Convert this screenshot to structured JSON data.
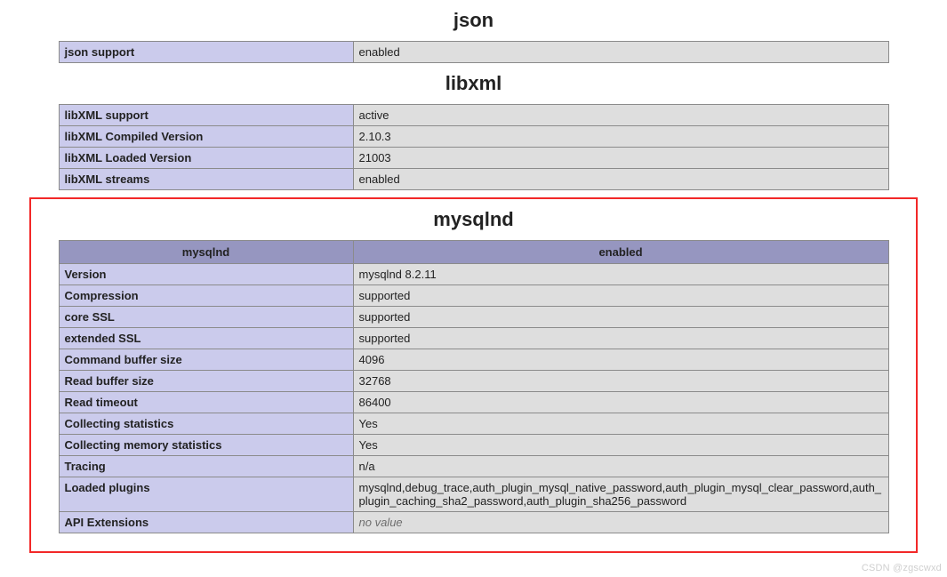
{
  "sections": {
    "json": {
      "title": "json",
      "rows": [
        {
          "key": "json support",
          "val": "enabled"
        }
      ]
    },
    "libxml": {
      "title": "libxml",
      "rows": [
        {
          "key": "libXML support",
          "val": "active"
        },
        {
          "key": "libXML Compiled Version",
          "val": "2.10.3"
        },
        {
          "key": "libXML Loaded Version",
          "val": "21003"
        },
        {
          "key": "libXML streams",
          "val": "enabled"
        }
      ]
    },
    "mysqlnd": {
      "title": "mysqlnd",
      "header": {
        "left": "mysqlnd",
        "right": "enabled"
      },
      "rows": [
        {
          "key": "Version",
          "val": "mysqlnd 8.2.11"
        },
        {
          "key": "Compression",
          "val": "supported"
        },
        {
          "key": "core SSL",
          "val": "supported"
        },
        {
          "key": "extended SSL",
          "val": "supported"
        },
        {
          "key": "Command buffer size",
          "val": "4096"
        },
        {
          "key": "Read buffer size",
          "val": "32768"
        },
        {
          "key": "Read timeout",
          "val": "86400"
        },
        {
          "key": "Collecting statistics",
          "val": "Yes"
        },
        {
          "key": "Collecting memory statistics",
          "val": "Yes"
        },
        {
          "key": "Tracing",
          "val": "n/a"
        },
        {
          "key": "Loaded plugins",
          "val": "mysqlnd,debug_trace,auth_plugin_mysql_native_password,auth_plugin_mysql_clear_password,auth_plugin_caching_sha2_password,auth_plugin_sha256_password"
        },
        {
          "key": "API Extensions",
          "val": "no value",
          "novalue": true
        }
      ]
    }
  },
  "watermark": "CSDN @zgscwxd"
}
